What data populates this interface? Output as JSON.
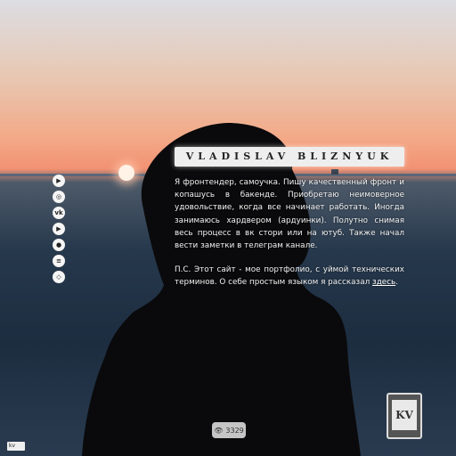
{
  "header": {
    "title": "VLADISLAV BLIZNYUK"
  },
  "bio": {
    "p1": "Я фронтендер, самоучка. Пишу качественный фронт и копашусь в бакенде. Приобретаю неимоверное удовольствие, когда все начинает работать. Иногда занимаюсь хардвером (ардуинки). Полутно снимая весь процесс в вк стори или на ютуб. Также начал вести заметки в телеграм канале.",
    "p2_prefix": "П.С. Этот сайт - мое портфолио, с уймой технических терминов. О себе простым языком я рассказал ",
    "p2_link": "здесь",
    "p2_suffix": "."
  },
  "social": [
    {
      "icon": "play-icon",
      "glyph": "▶"
    },
    {
      "icon": "instagram-icon",
      "glyph": "◎"
    },
    {
      "icon": "vk-icon",
      "glyph": "vk"
    },
    {
      "icon": "youtube-icon",
      "glyph": "▶"
    },
    {
      "icon": "github-icon",
      "glyph": "●"
    },
    {
      "icon": "stackoverflow-icon",
      "glyph": "≡"
    },
    {
      "icon": "codepen-icon",
      "glyph": "◇"
    }
  ],
  "footer": {
    "views": "3329",
    "corner_label": "kv",
    "device_label": "KV"
  }
}
